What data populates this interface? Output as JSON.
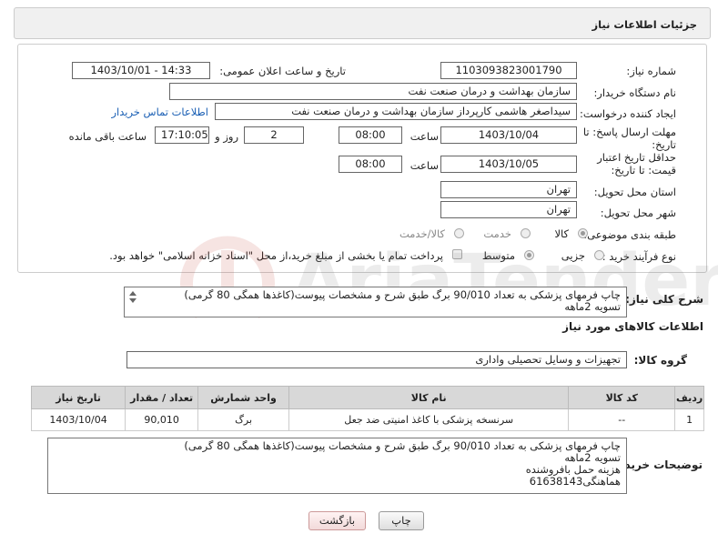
{
  "page": {
    "title": "جزئیات اطلاعات نیاز"
  },
  "form": {
    "need_number_label": "شماره نیاز:",
    "need_number": "1103093823001790",
    "announce_label": "تاریخ و ساعت اعلان عمومی:",
    "announce_value": "1403/10/01 - 14:33",
    "buyer_org_label": "نام دستگاه خریدار:",
    "buyer_org": "سازمان بهداشت و درمان صنعت نفت",
    "creator_label": "ایجاد کننده درخواست:",
    "creator": "سیداصغر هاشمی کارپرداز سازمان بهداشت و درمان صنعت نفت",
    "contact_link": "اطلاعات تماس خریدار",
    "reply_deadline_label": "مهلت ارسال پاسخ: تا تاریخ:",
    "reply_date": "1403/10/04",
    "time_label": "ساعت",
    "reply_time": "08:00",
    "days_value": "2",
    "days_label": "روز و",
    "remaining_time": "17:10:05",
    "remaining_label": "ساعت باقی مانده",
    "price_deadline_label": "حداقل تاریخ اعتبار قیمت: تا تاریخ:",
    "price_date": "1403/10/05",
    "price_time": "08:00",
    "province_label": "استان محل تحویل:",
    "province": "تهران",
    "city_label": "شهر محل تحویل:",
    "city": "تهران",
    "category_label": "طبقه بندی موضوعی:",
    "category_options": [
      "کالا",
      "خدمت",
      "کالا/خدمت"
    ],
    "process_label": "نوع فرآیند خرید :",
    "process_options": [
      "جزیی",
      "متوسط"
    ],
    "payment_note": "پرداخت تمام یا بخشی از مبلغ خرید،از محل \"اسناد خزانه اسلامی\" خواهد بود."
  },
  "summary": {
    "label": "شرح کلی نیاز:",
    "text": "چاپ فرمهای پزشکی به تعداد 90/010 برگ طبق شرح و مشخصات پیوست(کاغذها همگی 80 گرمی)\nتسویه 2ماهه"
  },
  "goods": {
    "section_title": "اطلاعات کالاهای مورد نیاز",
    "group_label": "گروه کالا:",
    "group_value": "تجهیزات و وسایل تحصیلی واداری",
    "columns": [
      "ردیف",
      "کد کالا",
      "نام کالا",
      "واحد شمارش",
      "تعداد / مقدار",
      "تاریخ نیاز"
    ],
    "rows": [
      [
        "1",
        "--",
        "سرنسخه پزشکی با کاغذ امنیتی ضد جعل",
        "برگ",
        "90,010",
        "1403/10/04"
      ]
    ]
  },
  "buyer_notes": {
    "label": "توضیحات خریدار:",
    "text": "چاپ فرمهای پزشکی به تعداد 90/010 برگ طبق شرح و مشخصات پیوست(کاغذها همگی 80 گرمی)\nتسویه 2ماهه\nهزینه حمل بافروشنده\nهماهنگی61638143"
  },
  "buttons": {
    "print": "چاپ",
    "back": "بازگشت"
  },
  "watermark": {
    "text": "AriaTender.neT"
  },
  "colors": {
    "link": "#1a5fb4",
    "header_bg": "#f0f0f0",
    "table_header_bg": "#d8d8d8",
    "watermark": "#c0392b"
  }
}
